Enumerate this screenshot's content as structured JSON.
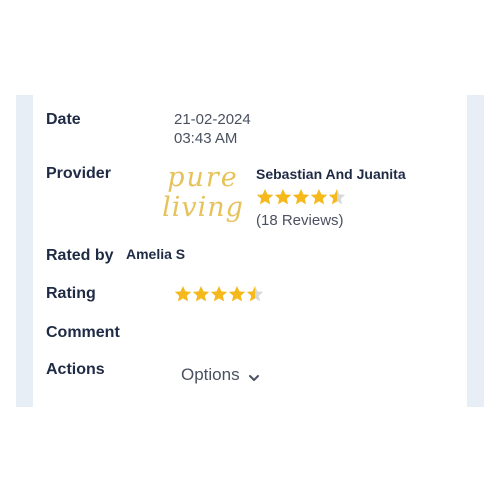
{
  "labels": {
    "date": "Date",
    "provider": "Provider",
    "rated_by": "Rated by",
    "rating": "Rating",
    "comment": "Comment",
    "actions": "Actions"
  },
  "date": {
    "day": "21-02-2024",
    "time": "03:43 AM"
  },
  "provider": {
    "logo_line1": "pure",
    "logo_line2": "living",
    "name": "Sebastian And Juanita",
    "rating": 4.5,
    "reviews": "(18 Reviews)"
  },
  "rated_by": "Amelia S",
  "rating": {
    "value": 4.5,
    "max": 5
  },
  "actions": {
    "options_label": "Options"
  },
  "colors": {
    "star": "#f5b91c",
    "star_empty": "#d9d9d9",
    "label": "#1f2a44",
    "value": "#4a5160",
    "logo": "#e6c25a",
    "side": "#e8eef5"
  }
}
